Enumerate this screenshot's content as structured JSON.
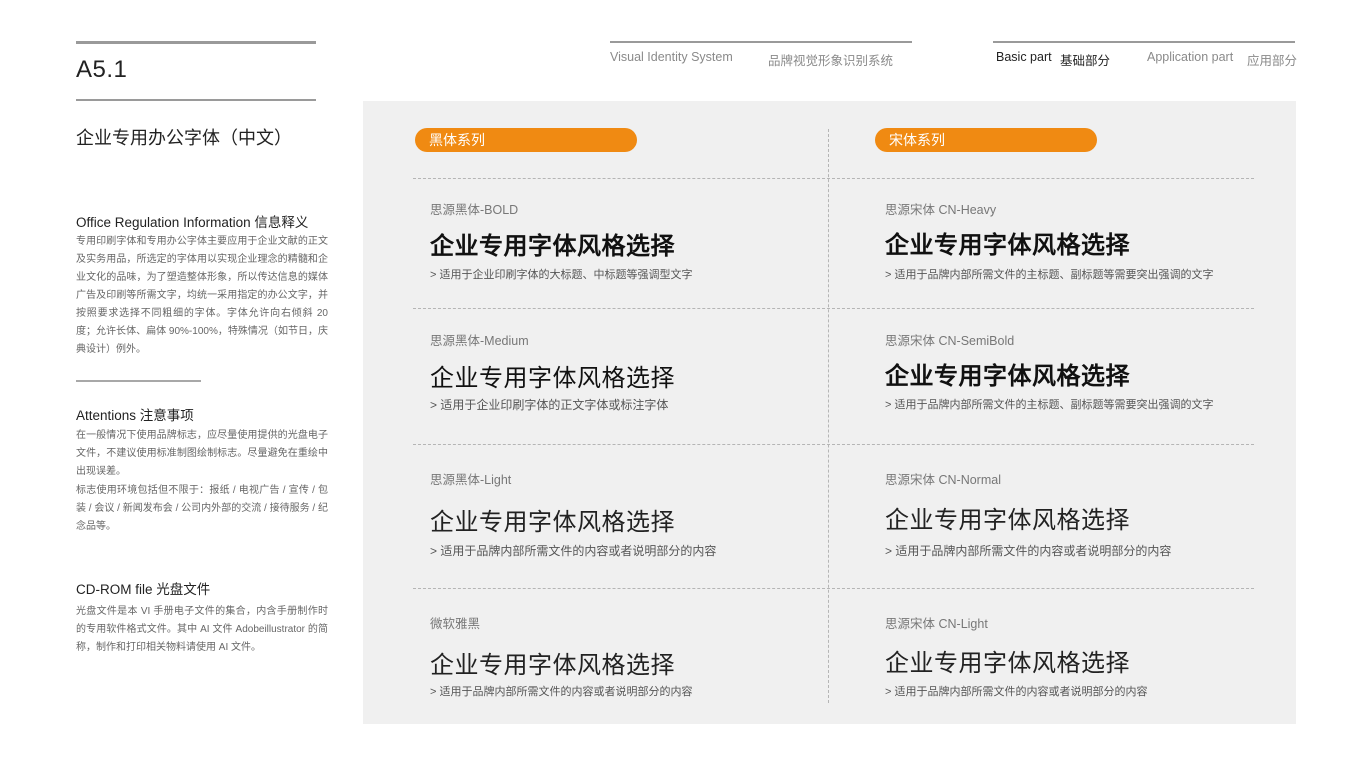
{
  "header": {
    "page_code": "A5.1",
    "page_title": "企业专用办公字体（中文）",
    "vi_en": "Visual Identity System",
    "vi_cn": "品牌视觉形象识别系统",
    "basic_en": "Basic part",
    "basic_cn": "基础部分",
    "app_en": "Application part",
    "app_cn": "应用部分"
  },
  "left": {
    "office_title": "Office Regulation Information 信息释义",
    "office_body": "专用印刷字体和专用办公字体主要应用于企业文献的正文及实务用品，所选定的字体用以实现企业理念的精髓和企业文化的品味，为了塑造整体形象，所以传达信息的媒体广告及印刷等所需文字，均统一采用指定的办公文字，并按照要求选择不同粗细的字体。字体允许向右倾斜 20 度；允许长体、扁体 90%-100%，特殊情况（如节日，庆典设计）例外。",
    "attention_title": "Attentions 注意事项",
    "attention_body": "在一般情况下使用品牌标志，应尽量使用提供的光盘电子文件，不建议使用标准制图绘制标志。尽量避免在重绘中出现误差。",
    "attention_env": "标志使用环境包括但不限于：报纸 / 电视广告 / 宣传 / 包装 / 会议 / 新闻发布会 / 公司内外部的交流 / 接待服务 / 纪念品等。",
    "cdrom_title": "CD-ROM file 光盘文件",
    "cdrom_body": "光盘文件是本 VI 手册电子文件的集合，内含手册制作时的专用软件格式文件。其中 AI 文件 Adobeillustrator 的简称，制作和打印相关物料请使用 AI 文件。"
  },
  "panel": {
    "col_left_title": "黑体系列",
    "col_right_title": "宋体系列",
    "accent_color": "#f08a12",
    "left_fonts": [
      {
        "name": "思源黑体-BOLD",
        "sample": "企业专用字体风格选择",
        "desc": "> 适用于企业印刷字体的大标题、中标题等强调型文字"
      },
      {
        "name": "思源黑体-Medium",
        "sample": "企业专用字体风格选择",
        "desc": "> 适用于企业印刷字体的正文字体或标注字体"
      },
      {
        "name": "思源黑体-Light",
        "sample": "企业专用字体风格选择",
        "desc": "> 适用于品牌内部所需文件的内容或者说明部分的内容"
      },
      {
        "name": "微软雅黑",
        "sample": "企业专用字体风格选择",
        "desc": "> 适用于品牌内部所需文件的内容或者说明部分的内容"
      }
    ],
    "right_fonts": [
      {
        "name": "思源宋体 CN-Heavy",
        "sample": "企业专用字体风格选择",
        "desc": "> 适用于品牌内部所需文件的主标题、副标题等需要突出强调的文字"
      },
      {
        "name": "思源宋体 CN-SemiBold",
        "sample": "企业专用字体风格选择",
        "desc": "> 适用于品牌内部所需文件的主标题、副标题等需要突出强调的文字"
      },
      {
        "name": "思源宋体 CN-Normal",
        "sample": "企业专用字体风格选择",
        "desc": "> 适用于品牌内部所需文件的内容或者说明部分的内容"
      },
      {
        "name": "思源宋体 CN-Light",
        "sample": "企业专用字体风格选择",
        "desc": "> 适用于品牌内部所需文件的内容或者说明部分的内容"
      }
    ]
  }
}
